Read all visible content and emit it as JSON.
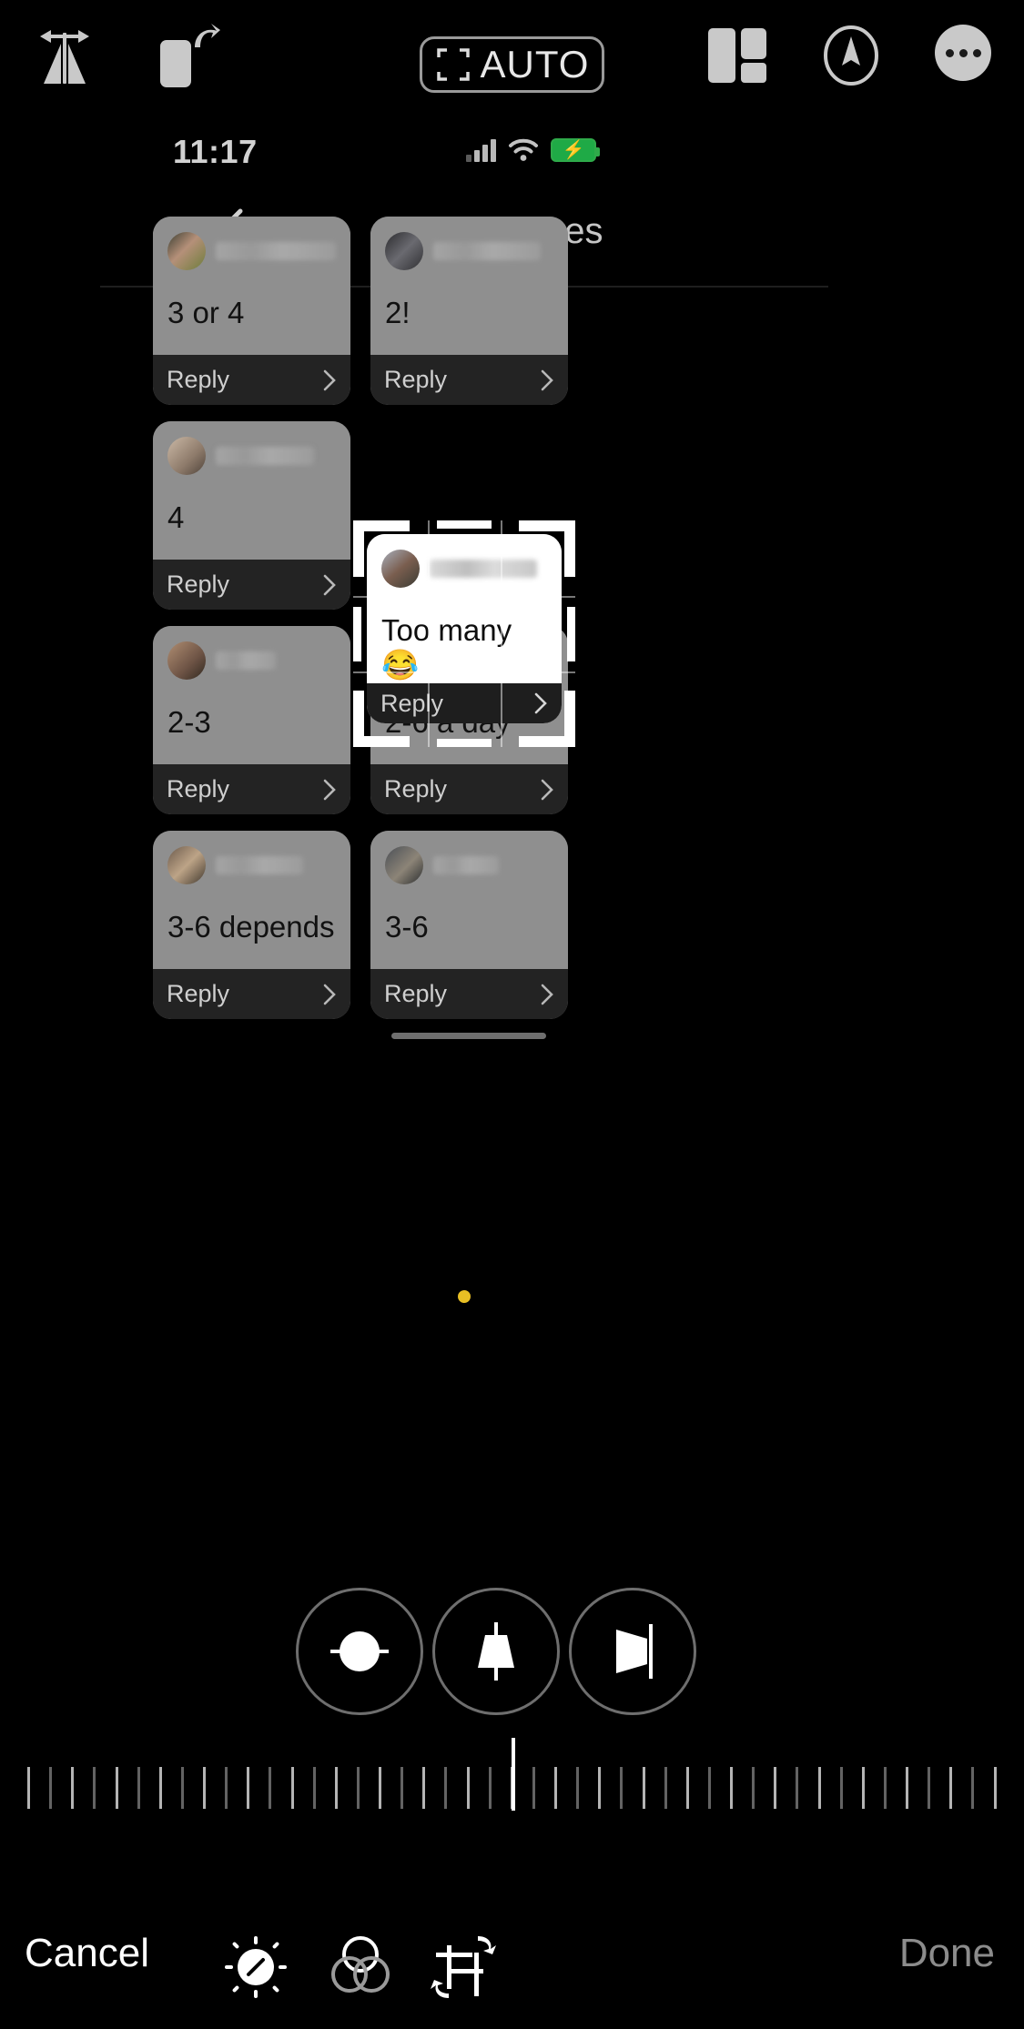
{
  "app": {
    "name": "photo-editor",
    "accent_yellow": "#e8bf24",
    "card_gray": "#8f8f8f",
    "card_footer_dark": "#232323"
  },
  "editor_toolbar": {
    "flip_icon": "flip-horizontal-icon",
    "rotate_icon": "rotate-icon",
    "auto_label": "AUTO",
    "auto_icon": "auto-frame-icon",
    "aspect_icon": "aspect-ratio-icon",
    "markup_icon": "markup-pen-icon",
    "more_icon": "more-options-icon"
  },
  "photo": {
    "statusbar": {
      "time": "11:17",
      "signal_icon": "cellular-signal-icon",
      "wifi_icon": "wifi-icon",
      "battery_icon": "battery-charging-icon",
      "battery_charging": true
    },
    "nav": {
      "back_icon": "chevron-left-icon",
      "title": "Responses"
    },
    "reply_label": "Reply",
    "reply_chevron_icon": "chevron-right-icon",
    "cards": [
      {
        "answer": "3 or 4",
        "username_redacted": true,
        "avatar": "a1",
        "name_width": "w2",
        "selected": false
      },
      {
        "answer": "2!",
        "username_redacted": true,
        "avatar": "a2",
        "name_width": "w6",
        "selected": false
      },
      {
        "answer": "4",
        "username_redacted": true,
        "avatar": "a3",
        "name_width": "w1",
        "selected": false
      },
      {
        "answer": "Too many 😂",
        "username_redacted": true,
        "avatar": "a4",
        "name_width": "w6",
        "selected": true
      },
      {
        "answer": "2-3",
        "username_redacted": true,
        "avatar": "a5",
        "name_width": "w4",
        "selected": false
      },
      {
        "answer": "2-6 a day",
        "username_redacted": true,
        "avatar": "a6",
        "name_width": "w5",
        "selected": false
      },
      {
        "answer": "3-6 depends",
        "username_redacted": true,
        "avatar": "a7",
        "name_width": "w3",
        "selected": false
      },
      {
        "answer": "3-6",
        "username_redacted": true,
        "avatar": "a8",
        "name_width": "w7",
        "selected": false
      }
    ]
  },
  "perspective_tools": [
    {
      "name": "straighten-tool",
      "icon": "straighten-icon"
    },
    {
      "name": "vertical-perspective-tool",
      "icon": "vertical-perspective-icon"
    },
    {
      "name": "horizontal-perspective-tool",
      "icon": "horizontal-perspective-icon"
    }
  ],
  "ruler": {
    "tick_count": 45,
    "center_value": 0
  },
  "bottom_bar": {
    "cancel_label": "Cancel",
    "done_label": "Done",
    "tools": [
      {
        "name": "adjust-tool",
        "icon": "adjust-dial-icon",
        "active": false
      },
      {
        "name": "filters-tool",
        "icon": "filters-circles-icon",
        "active": false
      },
      {
        "name": "crop-tool",
        "icon": "crop-rotate-icon",
        "active": true
      }
    ]
  }
}
